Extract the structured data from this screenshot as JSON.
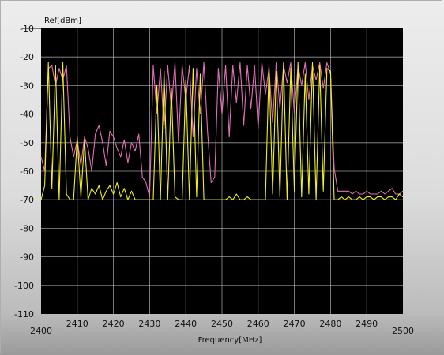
{
  "chart_data": {
    "type": "line",
    "ylabel": "Ref[dBm]",
    "xlabel": "Frequency[MHz]",
    "xlim": [
      2400,
      2500
    ],
    "ylim": [
      -110,
      -10
    ],
    "x_ticks": [
      "2400",
      "2410",
      "2420",
      "2430",
      "2440",
      "2450",
      "2460",
      "2470",
      "2480",
      "2490",
      "2500"
    ],
    "y_ticks": [
      "-10",
      "-20",
      "-30",
      "-40",
      "-50",
      "-60",
      "-70",
      "-80",
      "-90",
      "-100",
      "-110"
    ],
    "grid": true,
    "plot_background": "#000000",
    "series": [
      {
        "color": "#e070b8",
        "x": [
          2400,
          2401,
          2402,
          2403,
          2404,
          2405,
          2406,
          2407,
          2408,
          2409,
          2410,
          2411,
          2412,
          2413,
          2414,
          2415,
          2416,
          2417,
          2418,
          2419,
          2420,
          2421,
          2422,
          2423,
          2424,
          2425,
          2426,
          2427,
          2428,
          2429,
          2430,
          2431,
          2432,
          2433,
          2434,
          2435,
          2436,
          2437,
          2438,
          2439,
          2440,
          2441,
          2442,
          2443,
          2444,
          2445,
          2446,
          2447,
          2448,
          2449,
          2450,
          2451,
          2452,
          2453,
          2454,
          2455,
          2456,
          2457,
          2458,
          2459,
          2460,
          2461,
          2462,
          2463,
          2464,
          2465,
          2466,
          2467,
          2468,
          2469,
          2470,
          2471,
          2472,
          2473,
          2474,
          2475,
          2476,
          2477,
          2478,
          2479,
          2480,
          2481,
          2482,
          2483,
          2484,
          2485,
          2486,
          2487,
          2488,
          2489,
          2490,
          2491,
          2492,
          2493,
          2494,
          2495,
          2496,
          2497,
          2498,
          2499,
          2500
        ],
        "y": [
          -55,
          -60,
          -24,
          -23,
          -30,
          -24,
          -28,
          -23,
          -48,
          -55,
          -49,
          -58,
          -48,
          -52,
          -60,
          -47,
          -44,
          -50,
          -58,
          -46,
          -48,
          -52,
          -55,
          -49,
          -57,
          -50,
          -53,
          -47,
          -62,
          -64,
          -69,
          -23,
          -40,
          -24,
          -45,
          -23,
          -38,
          -22,
          -50,
          -23,
          -35,
          -23,
          -48,
          -24,
          -40,
          -22,
          -46,
          -64,
          -62,
          -24,
          -40,
          -23,
          -48,
          -23,
          -36,
          -22,
          -44,
          -23,
          -38,
          -23,
          -45,
          -22,
          -33,
          -24,
          -43,
          -22,
          -38,
          -23,
          -29,
          -22,
          -40,
          -23,
          -30,
          -22,
          -35,
          -23,
          -28,
          -22,
          -31,
          -22,
          -26,
          -59,
          -67,
          -67,
          -67,
          -67,
          -68,
          -67,
          -68,
          -68,
          -67,
          -68,
          -68,
          -68,
          -67,
          -68,
          -67,
          -66,
          -68,
          -68,
          -67
        ]
      },
      {
        "color": "#f0f020",
        "x": [
          2400,
          2401,
          2402,
          2403,
          2404,
          2405,
          2406,
          2407,
          2408,
          2409,
          2410,
          2411,
          2412,
          2413,
          2414,
          2415,
          2416,
          2417,
          2418,
          2419,
          2420,
          2421,
          2422,
          2423,
          2424,
          2425,
          2426,
          2427,
          2428,
          2429,
          2430,
          2431,
          2432,
          2433,
          2434,
          2435,
          2436,
          2437,
          2438,
          2439,
          2440,
          2441,
          2442,
          2443,
          2444,
          2445,
          2446,
          2447,
          2448,
          2449,
          2450,
          2451,
          2452,
          2453,
          2454,
          2455,
          2456,
          2457,
          2458,
          2459,
          2460,
          2461,
          2462,
          2463,
          2464,
          2465,
          2466,
          2467,
          2468,
          2469,
          2470,
          2471,
          2472,
          2473,
          2474,
          2475,
          2476,
          2477,
          2478,
          2479,
          2480,
          2481,
          2482,
          2483,
          2484,
          2485,
          2486,
          2487,
          2488,
          2489,
          2490,
          2491,
          2492,
          2493,
          2494,
          2495,
          2496,
          2497,
          2498,
          2499,
          2500
        ],
        "y": [
          -70,
          -65,
          -22,
          -66,
          -23,
          -70,
          -22,
          -68,
          -70,
          -70,
          -48,
          -69,
          -49,
          -70,
          -66,
          -68,
          -65,
          -70,
          -67,
          -65,
          -68,
          -64,
          -69,
          -66,
          -70,
          -67,
          -70,
          -70,
          -70,
          -70,
          -70,
          -70,
          -30,
          -70,
          -25,
          -70,
          -31,
          -69,
          -70,
          -70,
          -28,
          -70,
          -24,
          -69,
          -26,
          -70,
          -70,
          -70,
          -70,
          -70,
          -70,
          -70,
          -69,
          -70,
          -68,
          -70,
          -70,
          -69,
          -70,
          -70,
          -70,
          -70,
          -70,
          -23,
          -68,
          -25,
          -69,
          -22,
          -70,
          -24,
          -67,
          -22,
          -69,
          -26,
          -68,
          -22,
          -70,
          -23,
          -67,
          -24,
          -25,
          -70,
          -70,
          -69,
          -70,
          -69,
          -70,
          -70,
          -69,
          -70,
          -69,
          -69,
          -70,
          -69,
          -69,
          -70,
          -69,
          -69,
          -70,
          -68,
          -69
        ]
      }
    ]
  }
}
